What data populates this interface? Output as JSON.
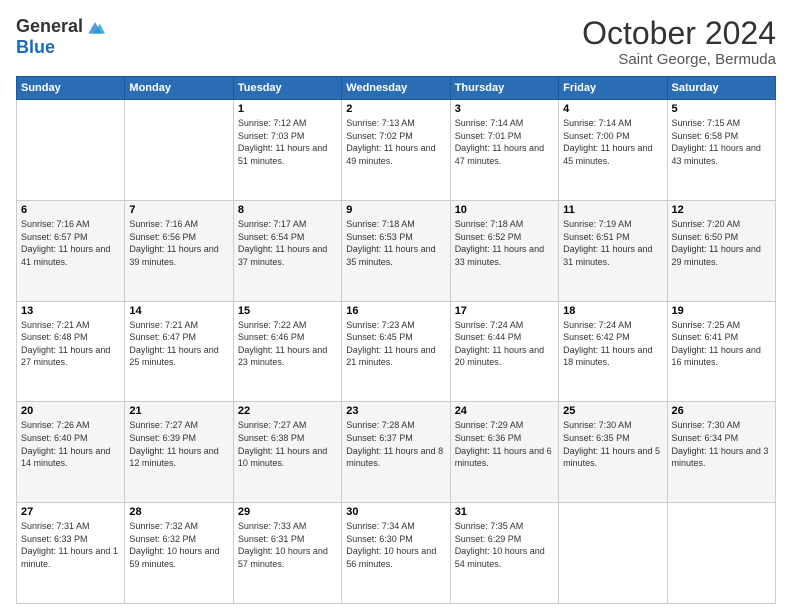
{
  "header": {
    "logo_general": "General",
    "logo_blue": "Blue",
    "title": "October 2024",
    "subtitle": "Saint George, Bermuda"
  },
  "days_of_week": [
    "Sunday",
    "Monday",
    "Tuesday",
    "Wednesday",
    "Thursday",
    "Friday",
    "Saturday"
  ],
  "weeks": [
    [
      {
        "num": "",
        "details": ""
      },
      {
        "num": "",
        "details": ""
      },
      {
        "num": "1",
        "details": "Sunrise: 7:12 AM\nSunset: 7:03 PM\nDaylight: 11 hours and 51 minutes."
      },
      {
        "num": "2",
        "details": "Sunrise: 7:13 AM\nSunset: 7:02 PM\nDaylight: 11 hours and 49 minutes."
      },
      {
        "num": "3",
        "details": "Sunrise: 7:14 AM\nSunset: 7:01 PM\nDaylight: 11 hours and 47 minutes."
      },
      {
        "num": "4",
        "details": "Sunrise: 7:14 AM\nSunset: 7:00 PM\nDaylight: 11 hours and 45 minutes."
      },
      {
        "num": "5",
        "details": "Sunrise: 7:15 AM\nSunset: 6:58 PM\nDaylight: 11 hours and 43 minutes."
      }
    ],
    [
      {
        "num": "6",
        "details": "Sunrise: 7:16 AM\nSunset: 6:57 PM\nDaylight: 11 hours and 41 minutes."
      },
      {
        "num": "7",
        "details": "Sunrise: 7:16 AM\nSunset: 6:56 PM\nDaylight: 11 hours and 39 minutes."
      },
      {
        "num": "8",
        "details": "Sunrise: 7:17 AM\nSunset: 6:54 PM\nDaylight: 11 hours and 37 minutes."
      },
      {
        "num": "9",
        "details": "Sunrise: 7:18 AM\nSunset: 6:53 PM\nDaylight: 11 hours and 35 minutes."
      },
      {
        "num": "10",
        "details": "Sunrise: 7:18 AM\nSunset: 6:52 PM\nDaylight: 11 hours and 33 minutes."
      },
      {
        "num": "11",
        "details": "Sunrise: 7:19 AM\nSunset: 6:51 PM\nDaylight: 11 hours and 31 minutes."
      },
      {
        "num": "12",
        "details": "Sunrise: 7:20 AM\nSunset: 6:50 PM\nDaylight: 11 hours and 29 minutes."
      }
    ],
    [
      {
        "num": "13",
        "details": "Sunrise: 7:21 AM\nSunset: 6:48 PM\nDaylight: 11 hours and 27 minutes."
      },
      {
        "num": "14",
        "details": "Sunrise: 7:21 AM\nSunset: 6:47 PM\nDaylight: 11 hours and 25 minutes."
      },
      {
        "num": "15",
        "details": "Sunrise: 7:22 AM\nSunset: 6:46 PM\nDaylight: 11 hours and 23 minutes."
      },
      {
        "num": "16",
        "details": "Sunrise: 7:23 AM\nSunset: 6:45 PM\nDaylight: 11 hours and 21 minutes."
      },
      {
        "num": "17",
        "details": "Sunrise: 7:24 AM\nSunset: 6:44 PM\nDaylight: 11 hours and 20 minutes."
      },
      {
        "num": "18",
        "details": "Sunrise: 7:24 AM\nSunset: 6:42 PM\nDaylight: 11 hours and 18 minutes."
      },
      {
        "num": "19",
        "details": "Sunrise: 7:25 AM\nSunset: 6:41 PM\nDaylight: 11 hours and 16 minutes."
      }
    ],
    [
      {
        "num": "20",
        "details": "Sunrise: 7:26 AM\nSunset: 6:40 PM\nDaylight: 11 hours and 14 minutes."
      },
      {
        "num": "21",
        "details": "Sunrise: 7:27 AM\nSunset: 6:39 PM\nDaylight: 11 hours and 12 minutes."
      },
      {
        "num": "22",
        "details": "Sunrise: 7:27 AM\nSunset: 6:38 PM\nDaylight: 11 hours and 10 minutes."
      },
      {
        "num": "23",
        "details": "Sunrise: 7:28 AM\nSunset: 6:37 PM\nDaylight: 11 hours and 8 minutes."
      },
      {
        "num": "24",
        "details": "Sunrise: 7:29 AM\nSunset: 6:36 PM\nDaylight: 11 hours and 6 minutes."
      },
      {
        "num": "25",
        "details": "Sunrise: 7:30 AM\nSunset: 6:35 PM\nDaylight: 11 hours and 5 minutes."
      },
      {
        "num": "26",
        "details": "Sunrise: 7:30 AM\nSunset: 6:34 PM\nDaylight: 11 hours and 3 minutes."
      }
    ],
    [
      {
        "num": "27",
        "details": "Sunrise: 7:31 AM\nSunset: 6:33 PM\nDaylight: 11 hours and 1 minute."
      },
      {
        "num": "28",
        "details": "Sunrise: 7:32 AM\nSunset: 6:32 PM\nDaylight: 10 hours and 59 minutes."
      },
      {
        "num": "29",
        "details": "Sunrise: 7:33 AM\nSunset: 6:31 PM\nDaylight: 10 hours and 57 minutes."
      },
      {
        "num": "30",
        "details": "Sunrise: 7:34 AM\nSunset: 6:30 PM\nDaylight: 10 hours and 56 minutes."
      },
      {
        "num": "31",
        "details": "Sunrise: 7:35 AM\nSunset: 6:29 PM\nDaylight: 10 hours and 54 minutes."
      },
      {
        "num": "",
        "details": ""
      },
      {
        "num": "",
        "details": ""
      }
    ]
  ]
}
